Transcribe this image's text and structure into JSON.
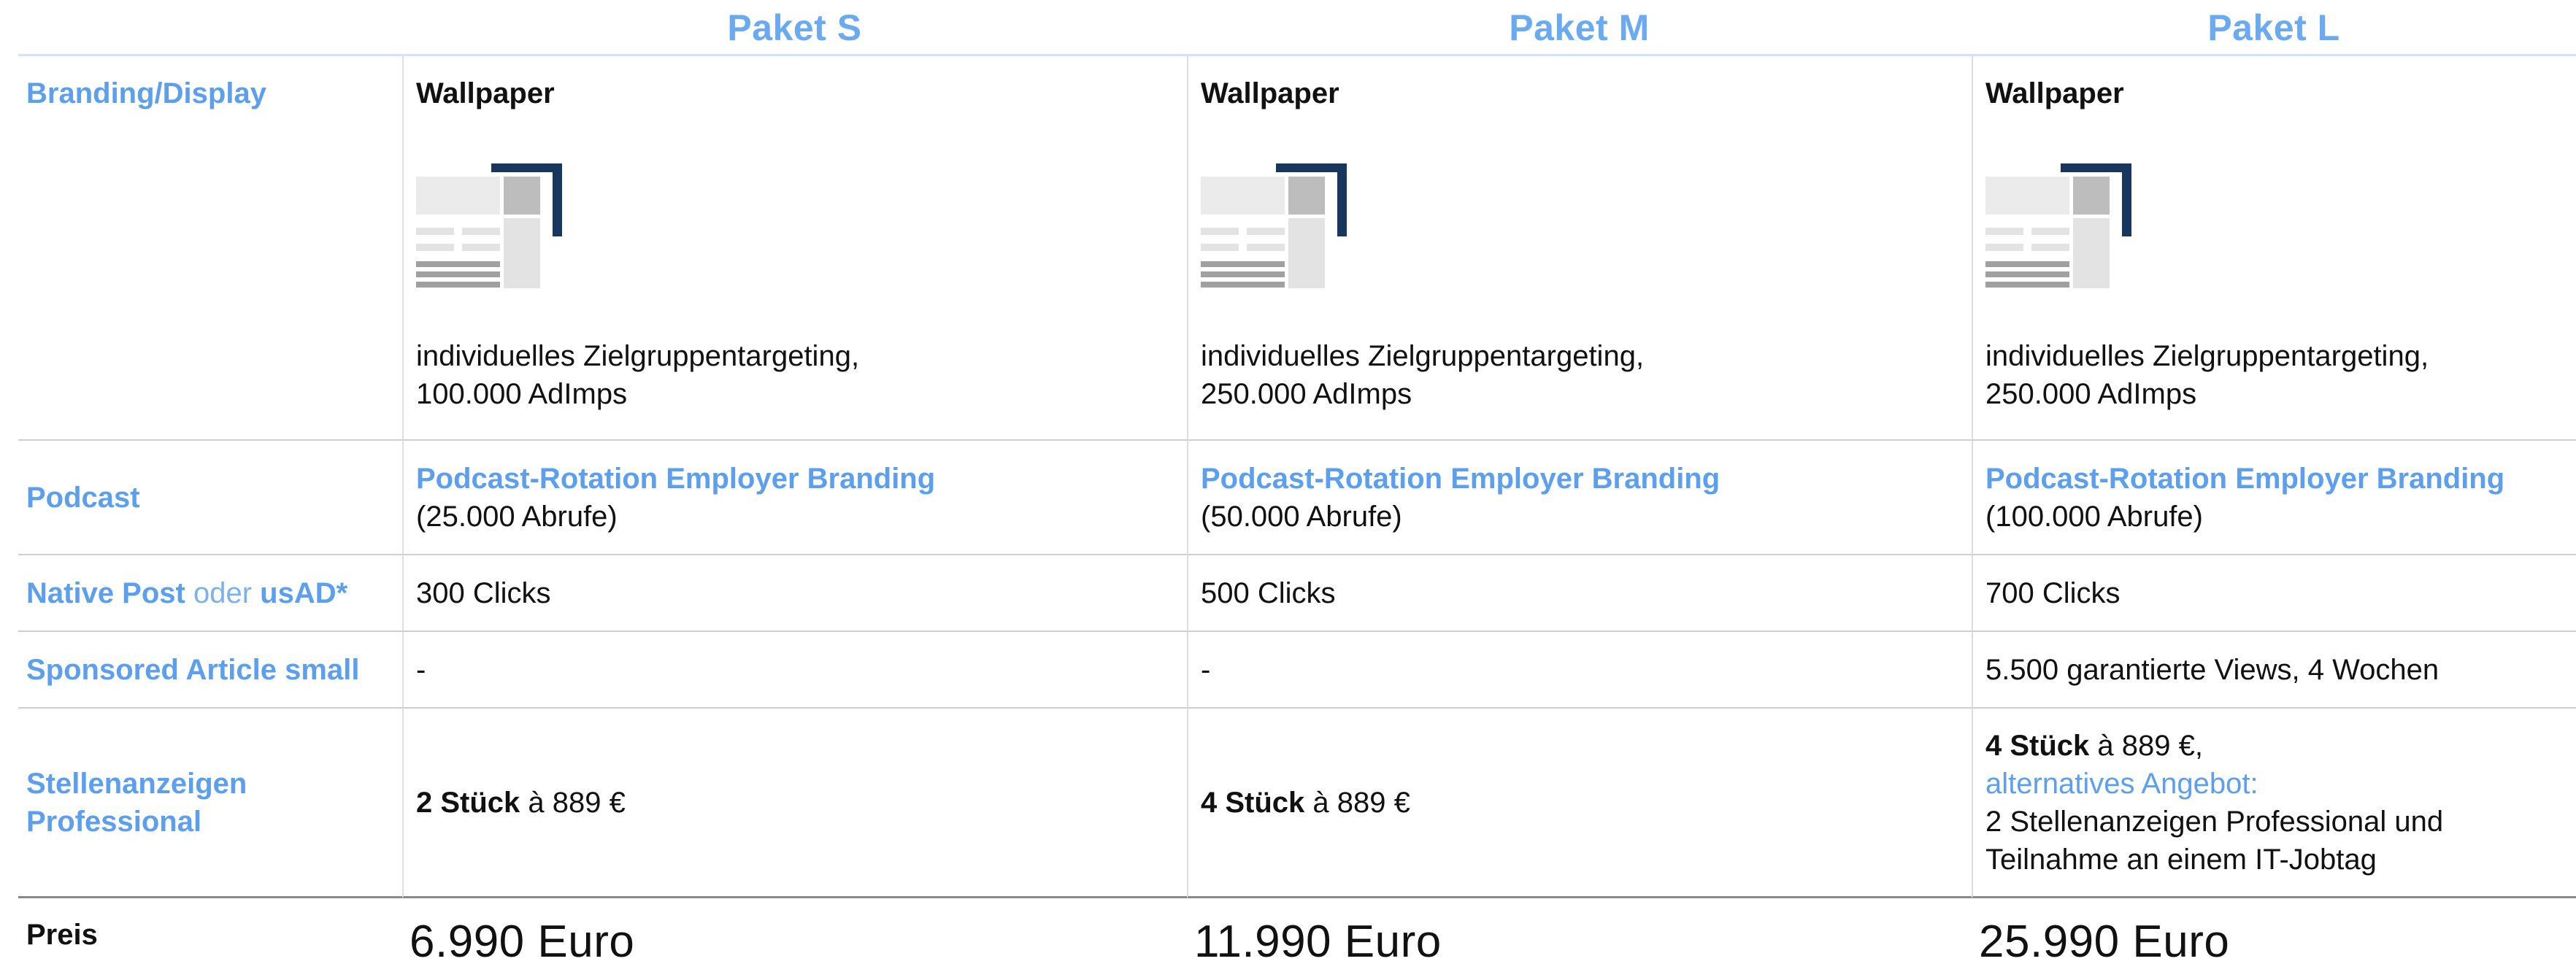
{
  "packages": [
    {
      "title": "Paket S"
    },
    {
      "title": "Paket M"
    },
    {
      "title": "Paket L"
    }
  ],
  "rows": {
    "branding": {
      "label": "Branding/Display",
      "values": [
        {
          "title": "Wallpaper",
          "line1": "individuelles Zielgruppentargeting,",
          "line2": "100.000 AdImps"
        },
        {
          "title": "Wallpaper",
          "line1": "individuelles Zielgruppentargeting,",
          "line2": "250.000 AdImps"
        },
        {
          "title": "Wallpaper",
          "line1": "individuelles Zielgruppentargeting,",
          "line2": "250.000 AdImps"
        }
      ]
    },
    "podcast": {
      "label": "Podcast",
      "values": [
        {
          "link": "Podcast-Rotation Employer Branding",
          "detail": "(25.000 Abrufe)"
        },
        {
          "link": "Podcast-Rotation Employer Branding",
          "detail": "(50.000 Abrufe)"
        },
        {
          "link": "Podcast-Rotation Employer Branding",
          "detail": "(100.000 Abrufe)"
        }
      ]
    },
    "native": {
      "label_part1": "Native Post",
      "label_part2": " oder ",
      "label_part3": "usAD*",
      "values": [
        "300 Clicks",
        "500 Clicks",
        "700 Clicks"
      ]
    },
    "sponsored": {
      "label": "Sponsored Article small",
      "values": [
        "-",
        "-",
        "5.500 garantierte Views, 4 Wochen"
      ]
    },
    "stellen": {
      "label_line1": "Stellenanzeigen",
      "label_line2": "Professional",
      "values": [
        {
          "count": "2 Stück",
          "price": " à 889 €"
        },
        {
          "count": "4 Stück",
          "price": " à 889 €"
        },
        {
          "count": "4 Stück",
          "price": " à 889 €,",
          "alt_label": "alternatives Angebot:",
          "alt_line1": "2 Stellenanzeigen Professional und",
          "alt_line2": "Teilnahme an einem IT-Jobtag"
        }
      ]
    },
    "price": {
      "label": "Preis",
      "values": [
        "6.990 Euro",
        "11.990 Euro",
        "25.990 Euro"
      ]
    }
  },
  "colors": {
    "accent": "#6aaaf2",
    "label_blue": "#5b9fee",
    "icon_navy": "#17375e",
    "icon_grey": "#c0c0c0"
  }
}
